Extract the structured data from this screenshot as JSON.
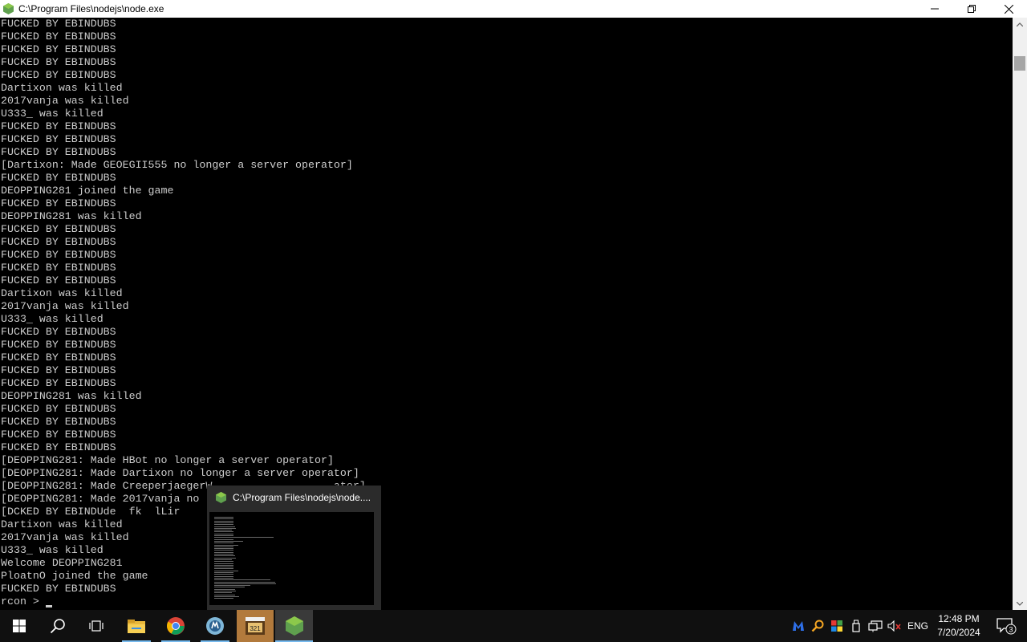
{
  "window": {
    "title": "C:\\Program Files\\nodejs\\node.exe",
    "icon": "nodejs-icon"
  },
  "console": {
    "lines": [
      "FUCKED BY EBINDUBS",
      "FUCKED BY EBINDUBS",
      "FUCKED BY EBINDUBS",
      "FUCKED BY EBINDUBS",
      "FUCKED BY EBINDUBS",
      "Dartixon was killed",
      "2017vanja was killed",
      "U333_ was killed",
      "FUCKED BY EBINDUBS",
      "FUCKED BY EBINDUBS",
      "FUCKED BY EBINDUBS",
      "[Dartixon: Made GEOEGII555 no longer a server operator]",
      "FUCKED BY EBINDUBS",
      "DEOPPING281 joined the game",
      "FUCKED BY EBINDUBS",
      "DEOPPING281 was killed",
      "FUCKED BY EBINDUBS",
      "FUCKED BY EBINDUBS",
      "FUCKED BY EBINDUBS",
      "FUCKED BY EBINDUBS",
      "FUCKED BY EBINDUBS",
      "Dartixon was killed",
      "2017vanja was killed",
      "U333_ was killed",
      "FUCKED BY EBINDUBS",
      "FUCKED BY EBINDUBS",
      "FUCKED BY EBINDUBS",
      "FUCKED BY EBINDUBS",
      "FUCKED BY EBINDUBS",
      "DEOPPING281 was killed",
      "FUCKED BY EBINDUBS",
      "FUCKED BY EBINDUBS",
      "FUCKED BY EBINDUBS",
      "FUCKED BY EBINDUBS",
      "[DEOPPING281: Made HBot no longer a server operator]",
      "[DEOPPING281: Made Dartixon no longer a server operator]",
      "[DEOPPING281: Made CreeperjaegerW                   ator]",
      "[DEOPPING281: Made 2017vanja no l",
      "[DCKED BY EBINDUde  fk  lLir",
      "Dartixon was killed",
      "2017vanja was killed",
      "U333_ was killed",
      "Welcome DEOPPING281",
      "PloatnO joined the game",
      "FUCKED BY EBINDUBS"
    ],
    "prompt": "rcon > "
  },
  "preview": {
    "title": "C:\\Program Files\\nodejs\\node...."
  },
  "taskbar": {
    "apps": [
      "start-icon",
      "search-icon",
      "task-view-icon",
      "file-explorer-icon",
      "chrome-icon",
      "app-icon",
      "media-player-icon",
      "nodejs-icon"
    ],
    "language": "ENG",
    "time": "12:48 PM",
    "date": "7/20/2024",
    "notifications": "3"
  },
  "colors": {
    "console_bg": "#000000",
    "console_text": "#cccccc",
    "node_green": "#6cc24a",
    "taskbar_bg": "#101010"
  }
}
